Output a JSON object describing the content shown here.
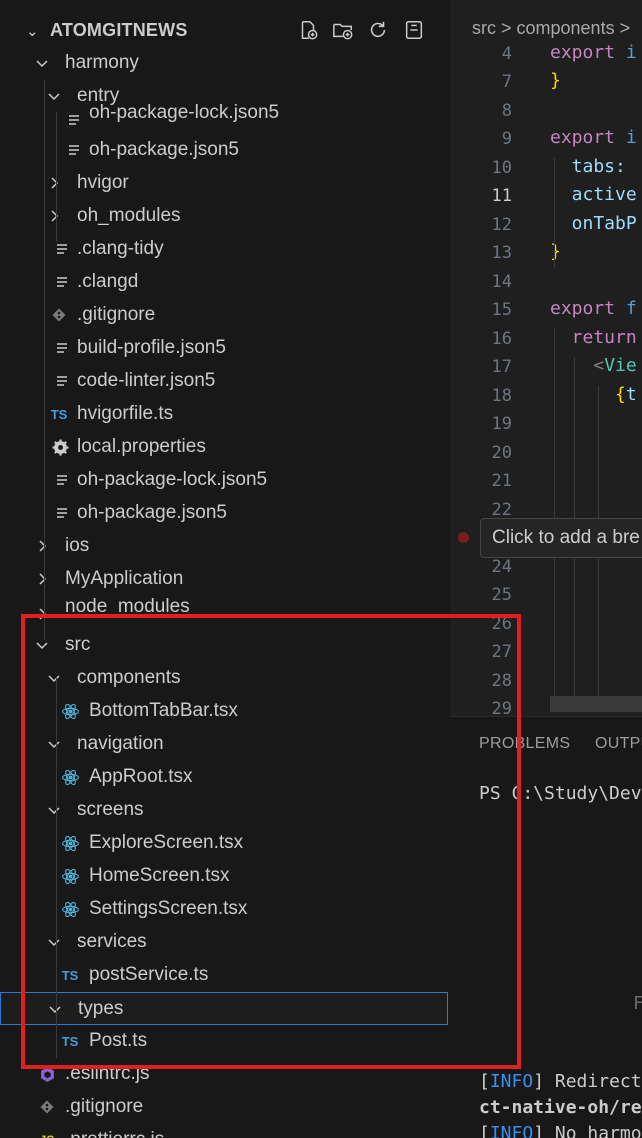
{
  "explorer": {
    "title": "ATOMGITNEWS",
    "actions": [
      "new-file",
      "new-folder",
      "refresh",
      "collapse-all"
    ],
    "tree": [
      {
        "label": "harmony",
        "kind": "folder",
        "open": true
      },
      {
        "label": "entry",
        "kind": "folder",
        "open": true
      },
      {
        "label": "oh-package-lock.json5",
        "kind": "file-lines"
      },
      {
        "label": "oh-package.json5",
        "kind": "file-lines"
      },
      {
        "label": "hvigor",
        "kind": "folder",
        "open": false
      },
      {
        "label": "oh_modules",
        "kind": "folder",
        "open": false
      },
      {
        "label": ".clang-tidy",
        "kind": "file-lines"
      },
      {
        "label": ".clangd",
        "kind": "file-lines"
      },
      {
        "label": ".gitignore",
        "kind": "git"
      },
      {
        "label": "build-profile.json5",
        "kind": "file-lines"
      },
      {
        "label": "code-linter.json5",
        "kind": "file-lines"
      },
      {
        "label": "hvigorfile.ts",
        "kind": "ts"
      },
      {
        "label": "local.properties",
        "kind": "gear"
      },
      {
        "label": "oh-package-lock.json5",
        "kind": "file-lines"
      },
      {
        "label": "oh-package.json5",
        "kind": "file-lines"
      },
      {
        "label": "ios",
        "kind": "folder",
        "open": false
      },
      {
        "label": "MyApplication",
        "kind": "folder",
        "open": false
      },
      {
        "label": "node_modules",
        "kind": "folder",
        "open": false
      },
      {
        "label": "src",
        "kind": "folder",
        "open": true
      },
      {
        "label": "components",
        "kind": "folder",
        "open": true
      },
      {
        "label": "BottomTabBar.tsx",
        "kind": "react"
      },
      {
        "label": "navigation",
        "kind": "folder",
        "open": true
      },
      {
        "label": "AppRoot.tsx",
        "kind": "react"
      },
      {
        "label": "screens",
        "kind": "folder",
        "open": true
      },
      {
        "label": "ExploreScreen.tsx",
        "kind": "react"
      },
      {
        "label": "HomeScreen.tsx",
        "kind": "react"
      },
      {
        "label": "SettingsScreen.tsx",
        "kind": "react"
      },
      {
        "label": "services",
        "kind": "folder",
        "open": true
      },
      {
        "label": "postService.ts",
        "kind": "ts"
      },
      {
        "label": "types",
        "kind": "folder",
        "open": true
      },
      {
        "label": "Post.ts",
        "kind": "ts"
      },
      {
        "label": ".eslintrc.js",
        "kind": "eslint"
      },
      {
        "label": ".gitignore",
        "kind": "git"
      },
      {
        "label": ".prettierrc.js",
        "kind": "js"
      }
    ],
    "ts_badge": "TS"
  },
  "editor": {
    "breadcrumb": "src > components >",
    "lines": [
      {
        "num": "4",
        "code": "export i"
      },
      {
        "num": "7",
        "code": "}"
      },
      {
        "num": "8",
        "code": ""
      },
      {
        "num": "9",
        "code": "export i"
      },
      {
        "num": "10",
        "code": "  tabs:"
      },
      {
        "num": "11",
        "code": "  active"
      },
      {
        "num": "12",
        "code": "  onTabP"
      },
      {
        "num": "13",
        "code": "}"
      },
      {
        "num": "14",
        "code": ""
      },
      {
        "num": "15",
        "code": "export f"
      },
      {
        "num": "16",
        "code": "  return"
      },
      {
        "num": "17",
        "code": "    <Vie"
      },
      {
        "num": "18",
        "code": "      {t"
      },
      {
        "num": "19",
        "code": ""
      },
      {
        "num": "20",
        "code": ""
      },
      {
        "num": "21",
        "code": ""
      },
      {
        "num": "22",
        "code": ""
      },
      {
        "num": "24",
        "code": ""
      },
      {
        "num": "25",
        "code": ""
      },
      {
        "num": "26",
        "code": ""
      },
      {
        "num": "27",
        "code": ""
      },
      {
        "num": "28",
        "code": ""
      },
      {
        "num": "29",
        "code": ""
      }
    ],
    "active_line": "11",
    "tooltip": "Click to add a bre"
  },
  "panel": {
    "tabs": [
      "PROBLEMS",
      "OUTPU"
    ],
    "prompt": "PS C:\\Study\\Dev",
    "faint_letter": "F",
    "lines": [
      {
        "tag": "INFO",
        "text": " Redirect"
      },
      {
        "tag": "",
        "text": "ct-native-oh/re"
      },
      {
        "tag": "INFO",
        "text": " No harmo"
      }
    ]
  },
  "colors": {
    "highlight": "#e02020",
    "selection_border": "#2b79d1",
    "react_icon": "#4fb3d9",
    "ts_icon": "#4a9ad9"
  }
}
